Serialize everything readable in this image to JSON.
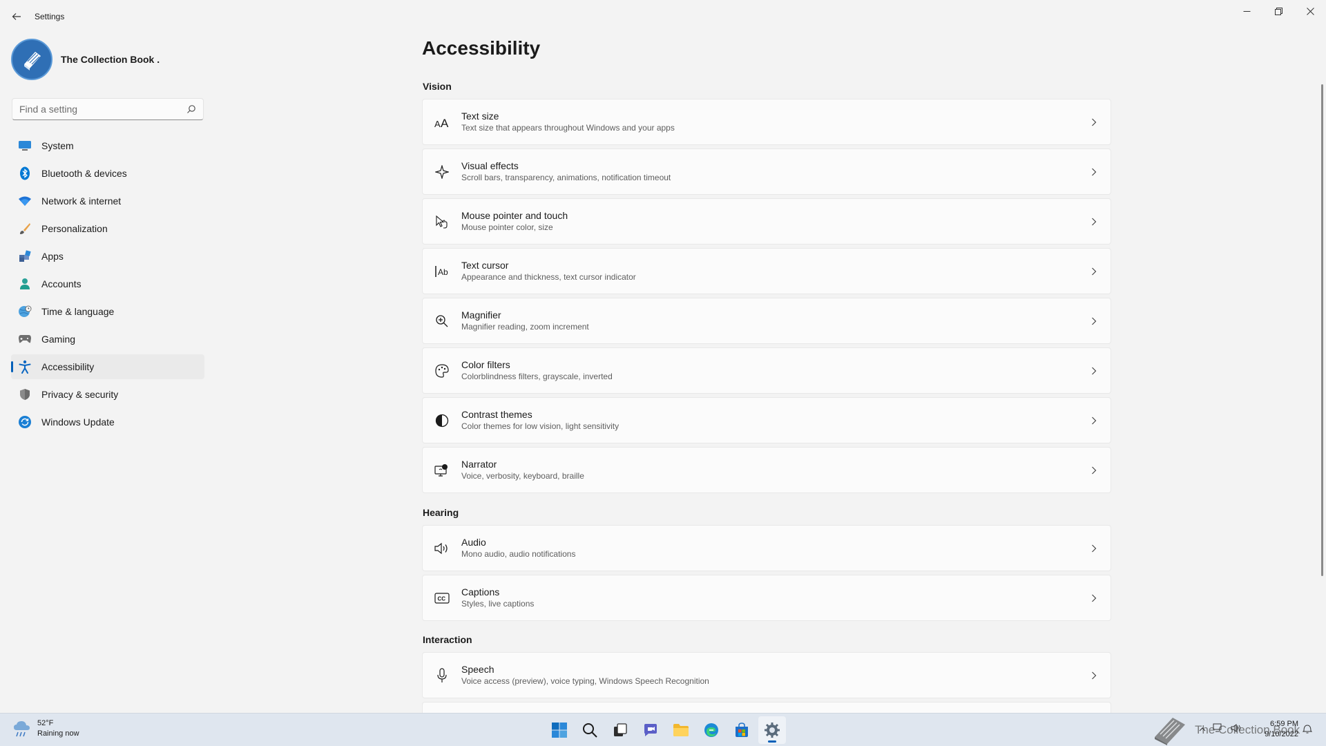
{
  "app": {
    "title": "Settings"
  },
  "profile": {
    "name": "The Collection Book ."
  },
  "search": {
    "placeholder": "Find a setting"
  },
  "nav": [
    {
      "label": "System",
      "icon": "monitor-icon"
    },
    {
      "label": "Bluetooth & devices",
      "icon": "bluetooth-icon"
    },
    {
      "label": "Network & internet",
      "icon": "wifi-icon"
    },
    {
      "label": "Personalization",
      "icon": "brush-icon"
    },
    {
      "label": "Apps",
      "icon": "apps-icon"
    },
    {
      "label": "Accounts",
      "icon": "person-icon"
    },
    {
      "label": "Time & language",
      "icon": "globe-clock-icon"
    },
    {
      "label": "Gaming",
      "icon": "gamepad-icon"
    },
    {
      "label": "Accessibility",
      "icon": "accessibility-icon",
      "active": true
    },
    {
      "label": "Privacy & security",
      "icon": "shield-icon"
    },
    {
      "label": "Windows Update",
      "icon": "update-icon"
    }
  ],
  "main": {
    "title": "Accessibility",
    "sections": {
      "vision": "Vision",
      "hearing": "Hearing",
      "interaction": "Interaction"
    },
    "items": [
      {
        "title": "Text size",
        "subtitle": "Text size that appears throughout Windows and your apps",
        "icon": "text-size-icon"
      },
      {
        "title": "Visual effects",
        "subtitle": "Scroll bars, transparency, animations, notification timeout",
        "icon": "sparkle-icon"
      },
      {
        "title": "Mouse pointer and touch",
        "subtitle": "Mouse pointer color, size",
        "icon": "pointer-touch-icon"
      },
      {
        "title": "Text cursor",
        "subtitle": "Appearance and thickness, text cursor indicator",
        "icon": "text-cursor-icon"
      },
      {
        "title": "Magnifier",
        "subtitle": "Magnifier reading, zoom increment",
        "icon": "magnifier-icon"
      },
      {
        "title": "Color filters",
        "subtitle": "Colorblindness filters, grayscale, inverted",
        "icon": "palette-icon"
      },
      {
        "title": "Contrast themes",
        "subtitle": "Color themes for low vision, light sensitivity",
        "icon": "contrast-icon"
      },
      {
        "title": "Narrator",
        "subtitle": "Voice, verbosity, keyboard, braille",
        "icon": "narrator-icon"
      },
      {
        "title": "Audio",
        "subtitle": "Mono audio, audio notifications",
        "icon": "speaker-icon"
      },
      {
        "title": "Captions",
        "subtitle": "Styles, live captions",
        "icon": "captions-icon"
      },
      {
        "title": "Speech",
        "subtitle": "Voice access (preview), voice typing, Windows Speech Recognition",
        "icon": "microphone-icon"
      }
    ]
  },
  "taskbar": {
    "weather": {
      "temp": "52°F",
      "condition": "Raining now"
    },
    "clock": {
      "time": "6:59 PM",
      "date": "9/10/2022"
    },
    "watermark": "The Collection Book"
  },
  "colors": {
    "accent": "#005fb8",
    "background": "#f3f3f3",
    "card": "#fbfbfb"
  }
}
